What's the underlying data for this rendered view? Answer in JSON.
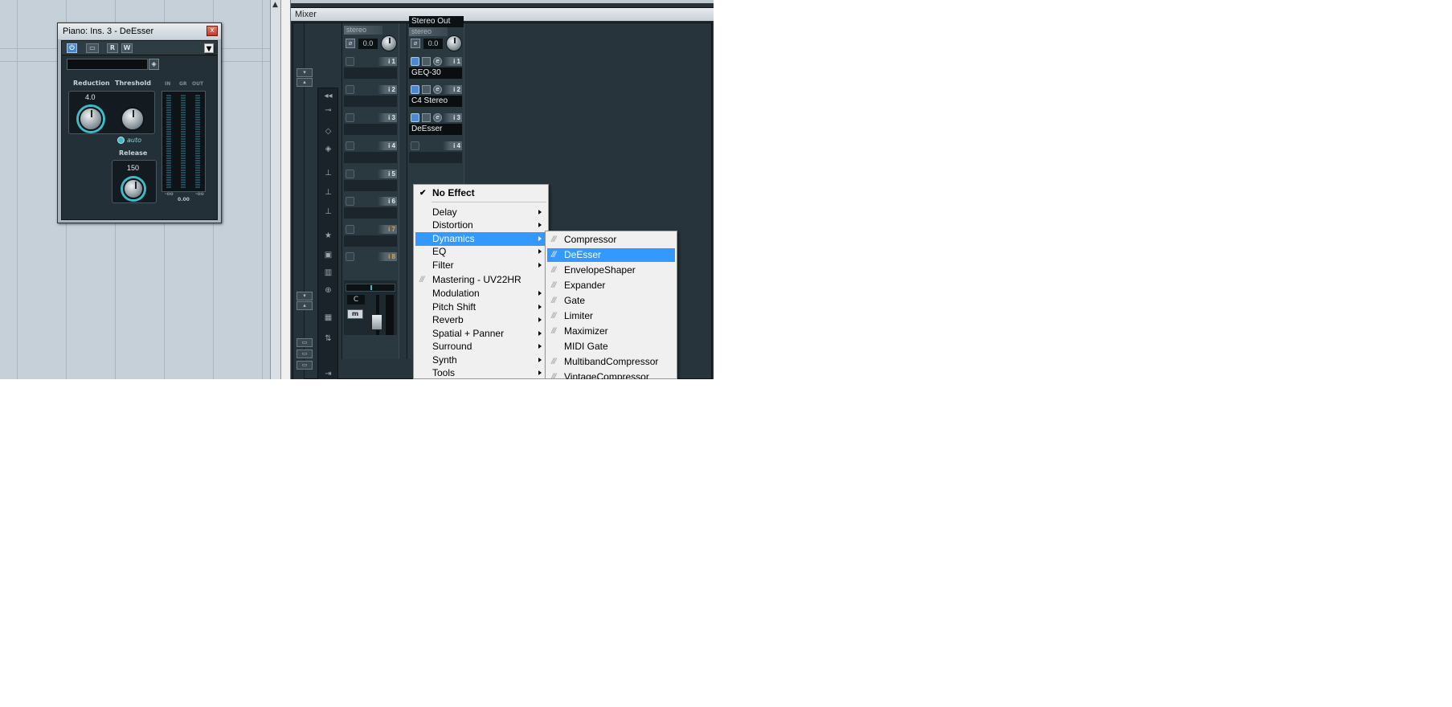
{
  "plugin": {
    "title": "Piano: Ins. 3 - DeEsser",
    "close_glyph": "x",
    "toolbar": {
      "r_label": "R",
      "w_label": "W"
    },
    "labels": {
      "reduction": "Reduction",
      "threshold": "Threshold",
      "release": "Release",
      "auto": "auto",
      "meter_in": "IN",
      "meter_gr": "GR",
      "meter_out": "OUT",
      "meter_min_left": "-oo",
      "meter_min_right": "-oo"
    },
    "values": {
      "reduction": "4.0",
      "release": "150",
      "meter_readout": "0.00"
    }
  },
  "mixer": {
    "title": "Mixer",
    "channels": [
      {
        "name": "",
        "type": "stereo",
        "gain": "0.0",
        "slots": [
          {
            "num": "i 1",
            "name": ""
          },
          {
            "num": "i 2",
            "name": ""
          },
          {
            "num": "i 3",
            "name": ""
          },
          {
            "num": "i 4",
            "name": ""
          },
          {
            "num": "i 5",
            "name": ""
          },
          {
            "num": "i 6",
            "name": ""
          },
          {
            "num": "i 7",
            "name": ""
          },
          {
            "num": "i 8",
            "name": ""
          }
        ],
        "pan_label": "C",
        "mute_label": "m"
      },
      {
        "name": "Stereo Out",
        "type": "stereo",
        "gain": "0.0",
        "slots": [
          {
            "num": "i 1",
            "name": "GEQ-30"
          },
          {
            "num": "i 2",
            "name": "C4 Stereo"
          },
          {
            "num": "i 3",
            "name": "DeEsser"
          },
          {
            "num": "i 4",
            "name": ""
          }
        ]
      }
    ]
  },
  "menu": {
    "no_effect": "No Effect",
    "items": [
      {
        "label": "Delay",
        "submenu": true
      },
      {
        "label": "Distortion",
        "submenu": true
      },
      {
        "label": "Dynamics",
        "submenu": true,
        "highlighted": true
      },
      {
        "label": "EQ",
        "submenu": true
      },
      {
        "label": "Filter",
        "submenu": true
      },
      {
        "label": "Mastering - UV22HR",
        "submenu": false,
        "plugin_stripe": true
      },
      {
        "label": "Modulation",
        "submenu": true
      },
      {
        "label": "Pitch Shift",
        "submenu": true
      },
      {
        "label": "Reverb",
        "submenu": true
      },
      {
        "label": "Spatial + Panner",
        "submenu": true
      },
      {
        "label": "Surround",
        "submenu": true
      },
      {
        "label": "Synth",
        "submenu": true
      },
      {
        "label": "Tools",
        "submenu": true
      }
    ],
    "dynamics_submenu": [
      {
        "label": "Compressor",
        "stripe": true
      },
      {
        "label": "DeEsser",
        "stripe": true,
        "highlighted": true
      },
      {
        "label": "EnvelopeShaper",
        "stripe": true
      },
      {
        "label": "Expander",
        "stripe": true
      },
      {
        "label": "Gate",
        "stripe": true
      },
      {
        "label": "Limiter",
        "stripe": true
      },
      {
        "label": "Maximizer",
        "stripe": true
      },
      {
        "label": "MIDI Gate",
        "stripe": false
      },
      {
        "label": "MultibandCompressor",
        "stripe": true
      },
      {
        "label": "VintageCompressor",
        "stripe": true
      }
    ],
    "stripe_glyph": "///",
    "check_glyph": "✔"
  },
  "colors": {
    "highlight": "#3399ff",
    "accent_teal": "#3dbbc7",
    "power_blue": "#4b8ad0"
  }
}
